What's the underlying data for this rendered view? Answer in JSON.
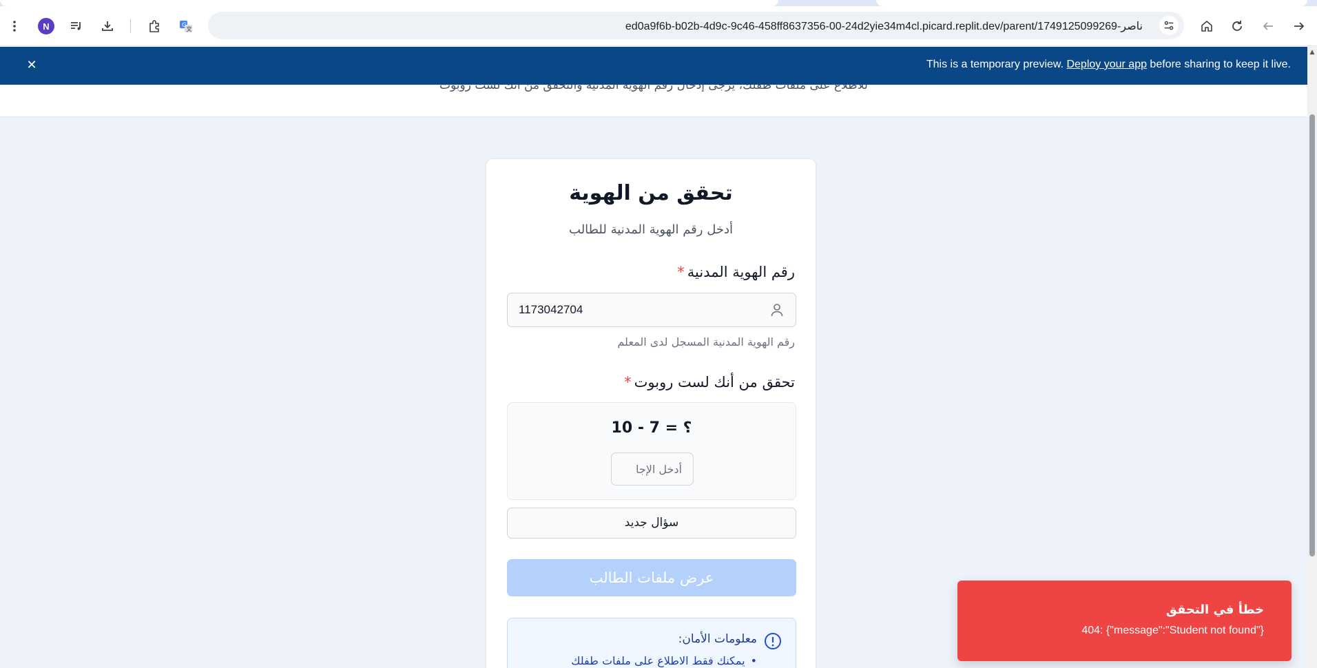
{
  "browser": {
    "url": "ed0a9f6b-b02b-4d9c-9c46-458ff8637356-00-24d2yie34m4cl.picard.replit.dev/parent/1749125099269-ناصر",
    "avatar_letter": "N",
    "icons": [
      "menu-icon",
      "profile-avatar",
      "media-icon",
      "download-icon",
      "extensions-icon",
      "translate-icon",
      "bookmark-star-icon",
      "site-settings-icon",
      "home-icon",
      "reload-icon",
      "back-icon",
      "forward-icon"
    ]
  },
  "banner": {
    "text_before": "This is a temporary preview. ",
    "link_text": "Deploy your app",
    "text_after": " before sharing to keep it live."
  },
  "header": {
    "partial_text": "للاطلاع على ملفات طفلك، يرجى إدخال رقم الهوية المدنية والتحقق من أنك لست روبوت"
  },
  "card": {
    "title": "تحقق من الهوية",
    "subtitle": "أدخل رقم الهوية المدنية للطالب",
    "id_label": "رقم الهوية المدنية",
    "required_mark": "*",
    "id_value": "1173042704",
    "id_hint": "رقم الهوية المدنية المسجل لدى المعلم",
    "captcha_label": "تحقق من أنك لست روبوت",
    "captcha_question": "10 - 7 = ؟",
    "captcha_placeholder": "أدخل الإجا",
    "new_question_button": "سؤال جديد",
    "submit_button": "عرض ملفات الطالب",
    "security_title": "معلومات الأمان:",
    "security_item": "يمكنك فقط الاطلاع على ملفات طفلك"
  },
  "toast": {
    "title": "خطأ في التحقق",
    "message": "404: {\"message\":\"Student not found\"}"
  },
  "colors": {
    "banner_bg": "#0a4787",
    "submit_disabled": "#b3d1fb",
    "toast_bg": "#ef4444",
    "required": "#ef4444",
    "page_bg": "#eef2fb"
  }
}
